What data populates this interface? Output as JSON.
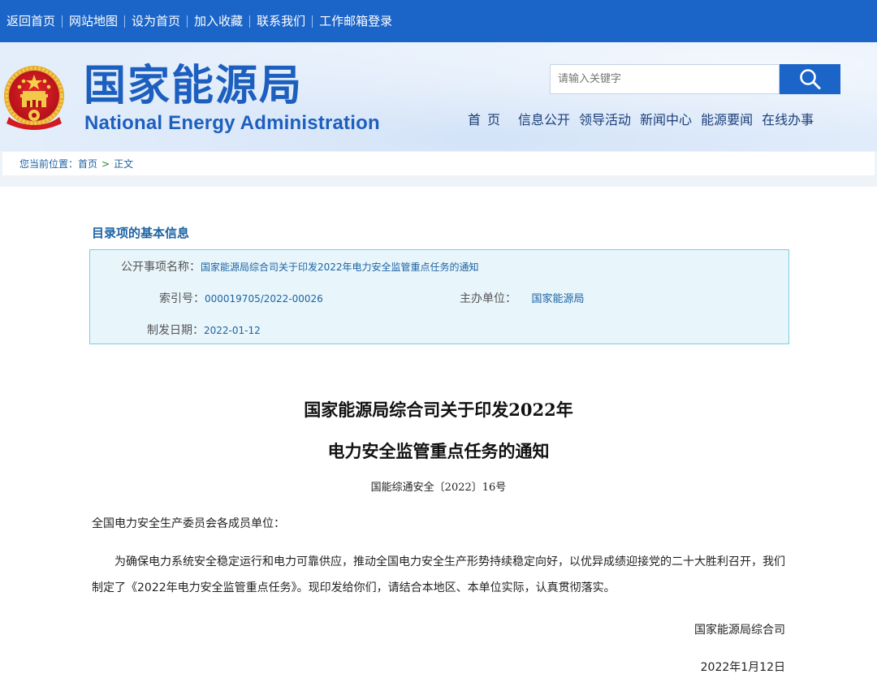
{
  "topbar": {
    "links": [
      "返回首页",
      "网站地图",
      "设为首页",
      "加入收藏",
      "联系我们",
      "工作邮箱登录"
    ]
  },
  "header": {
    "site_name_cn": "国家能源局",
    "site_name_en": "National Energy Administration",
    "search_placeholder": "请输入关键字",
    "nav": [
      "首页",
      "信息公开",
      "领导活动",
      "新闻中心",
      "能源要闻",
      "在线办事"
    ]
  },
  "breadcrumb": {
    "label": "您当前位置：",
    "home": "首页",
    "separator": ">",
    "current": "正文"
  },
  "info": {
    "section_title": "目录项的基本信息",
    "name_label": "公开事项名称：",
    "name_value": "国家能源局综合司关于印发2022年电力安全监管重点任务的通知",
    "index_label": "索引号：",
    "index_value": "000019705/2022-00026",
    "org_label": "主办单位：",
    "org_value": "国家能源局",
    "date_label": "制发日期：",
    "date_value": "2022-01-12"
  },
  "document": {
    "title_line1": "国家能源局综合司关于印发2022年",
    "title_line2": "电力安全监管重点任务的通知",
    "doc_number": "国能综通安全〔2022〕16号",
    "salutation": "全国电力安全生产委员会各成员单位：",
    "body": "为确保电力系统安全稳定运行和电力可靠供应，推动全国电力安全生产形势持续稳定向好，以优异成绩迎接党的二十大胜利召开，我们制定了《2022年电力安全监管重点任务》。现印发给你们，请结合本地区、本单位实际，认真贯彻落实。",
    "signature": "国家能源局综合司",
    "date": "2022年1月12日"
  },
  "colors": {
    "brand_blue": "#1b64c8",
    "link_blue": "#1d63a3",
    "info_bg": "#e8f5fb",
    "info_border": "#7dcce4"
  },
  "icons": {
    "emblem": "national-emblem-icon",
    "search": "search-icon"
  }
}
